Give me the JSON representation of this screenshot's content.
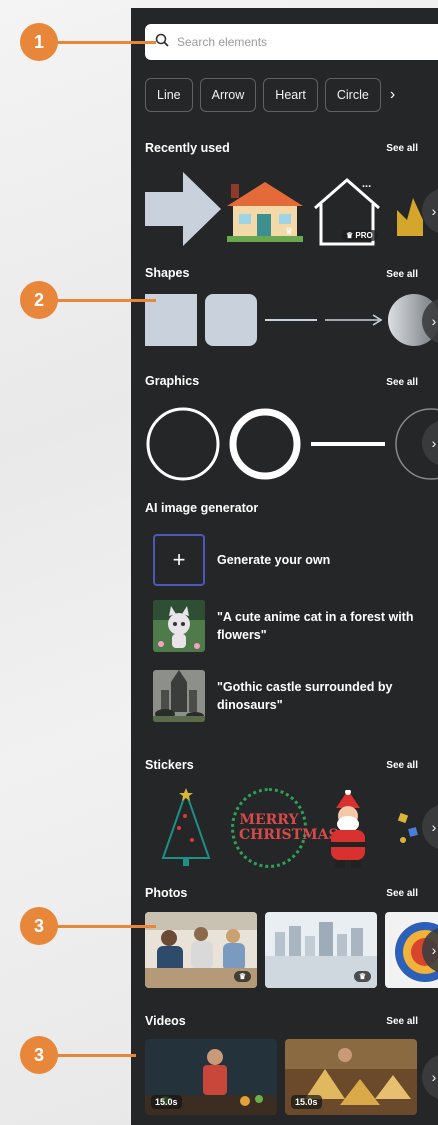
{
  "callouts": [
    "1",
    "2",
    "3",
    "3"
  ],
  "search": {
    "placeholder": "Search elements"
  },
  "chips": [
    "Line",
    "Arrow",
    "Heart",
    "Circle"
  ],
  "see_all": "See all",
  "sections": {
    "recently_used": "Recently used",
    "shapes": "Shapes",
    "graphics": "Graphics",
    "ai": "AI image generator",
    "stickers": "Stickers",
    "photos": "Photos",
    "videos": "Videos"
  },
  "recent": {
    "pro_badge": "PRO",
    "more": "..."
  },
  "ai_items": [
    {
      "text": "Generate your own"
    },
    {
      "text": "\"A cute anime cat in a forest with flowers\""
    },
    {
      "text": "\"Gothic castle surrounded by dinosaurs\""
    }
  ],
  "stickers": {
    "merry_christmas": "MERRY CHRISTMAS"
  },
  "videos": {
    "durations": [
      "15.0s",
      "15.0s"
    ]
  },
  "colors": {
    "accent": "#e8863a",
    "panel": "#252627",
    "generate_border": "#4d57b8"
  },
  "icons": [
    "search-icon",
    "chevron-right-icon",
    "plus-icon",
    "crown-icon"
  ]
}
